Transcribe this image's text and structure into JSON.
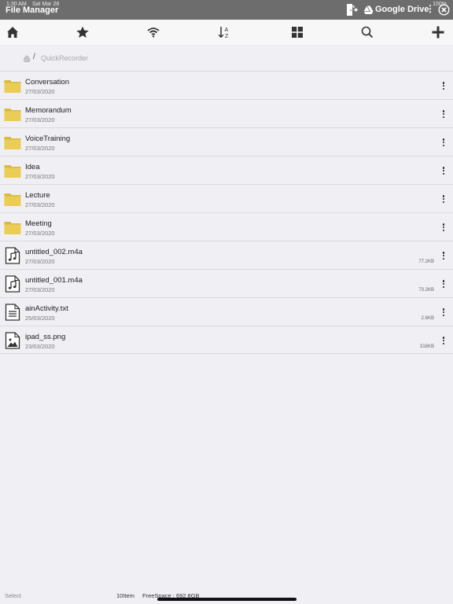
{
  "status_bar": {
    "time": "1:30 AM",
    "date": "Sat Mar 28",
    "battery": "100%"
  },
  "header": {
    "title": "File Manager",
    "cloud_label": "Google Drive",
    "more": "⋮"
  },
  "toolbar": {
    "icons": [
      "home-icon",
      "star-icon",
      "wifi-icon",
      "sort-az-icon",
      "grid-view-icon",
      "search-icon",
      "plus-icon"
    ]
  },
  "breadcrumb": {
    "separator": "/",
    "folder": "QuickRecorder"
  },
  "files": [
    {
      "name": "Conversation",
      "date": "27/03/2020",
      "size": "",
      "type": "folder"
    },
    {
      "name": "Memorandum",
      "date": "27/03/2020",
      "size": "",
      "type": "folder"
    },
    {
      "name": "VoiceTraining",
      "date": "27/03/2020",
      "size": "",
      "type": "folder"
    },
    {
      "name": "Idea",
      "date": "27/03/2020",
      "size": "",
      "type": "folder"
    },
    {
      "name": "Lecture",
      "date": "27/03/2020",
      "size": "",
      "type": "folder"
    },
    {
      "name": "Meeting",
      "date": "27/03/2020",
      "size": "",
      "type": "folder"
    },
    {
      "name": "untitled_002.m4a",
      "date": "27/03/2020",
      "size": "77.2KB",
      "type": "audio"
    },
    {
      "name": "untitled_001.m4a",
      "date": "27/03/2020",
      "size": "73.2KB",
      "type": "audio"
    },
    {
      "name": "ainActivity.txt",
      "date": "25/03/2020",
      "size": "2.6KB",
      "type": "text"
    },
    {
      "name": "ipad_ss.png",
      "date": "23/03/2020",
      "size": "316KB",
      "type": "image"
    }
  ],
  "footer": {
    "select_label": "Select",
    "item_count": "10Item",
    "free_space": "FreeSpace : 692.8GB"
  },
  "colors": {
    "header_bg": "#6d6d6d",
    "folder": "#e6c84a",
    "background": "#efeff4"
  }
}
